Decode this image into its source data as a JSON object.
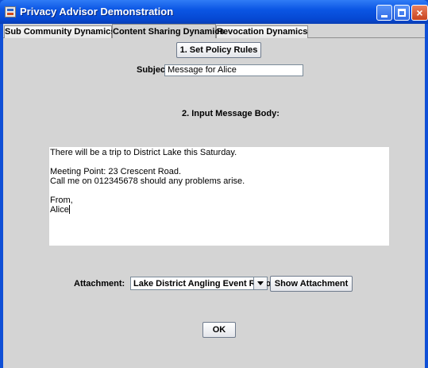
{
  "window": {
    "title": "Privacy Advisor Demonstration",
    "controls": {
      "minimize": "minimize",
      "maximize": "maximize",
      "close": "×"
    }
  },
  "tabs": [
    {
      "label": "Sub Community Dynamics",
      "active": false
    },
    {
      "label": "Content Sharing Dynamics",
      "active": true
    },
    {
      "label": "Revocation Dynamics",
      "active": false
    }
  ],
  "policy": {
    "button_label": "1. Set Policy Rules"
  },
  "subject": {
    "label": "Subject",
    "value": "Message for Alice"
  },
  "message": {
    "heading": "2. Input Message Body:",
    "lines": [
      "There will be a trip to District Lake this Saturday.",
      "",
      "Meeting Point: 23 Crescent Road.",
      "Call me on 012345678 should any problems arise.",
      "",
      "From,",
      "Alice"
    ]
  },
  "attachment": {
    "label": "Attachment:",
    "selected": "Lake District Angling Event Report",
    "show_button_label": "Show Attachment"
  },
  "ok_button_label": "OK",
  "colors": {
    "title_bar": "#0b56e4",
    "panel": "#d4d4d4",
    "close_button": "#c8431e"
  }
}
